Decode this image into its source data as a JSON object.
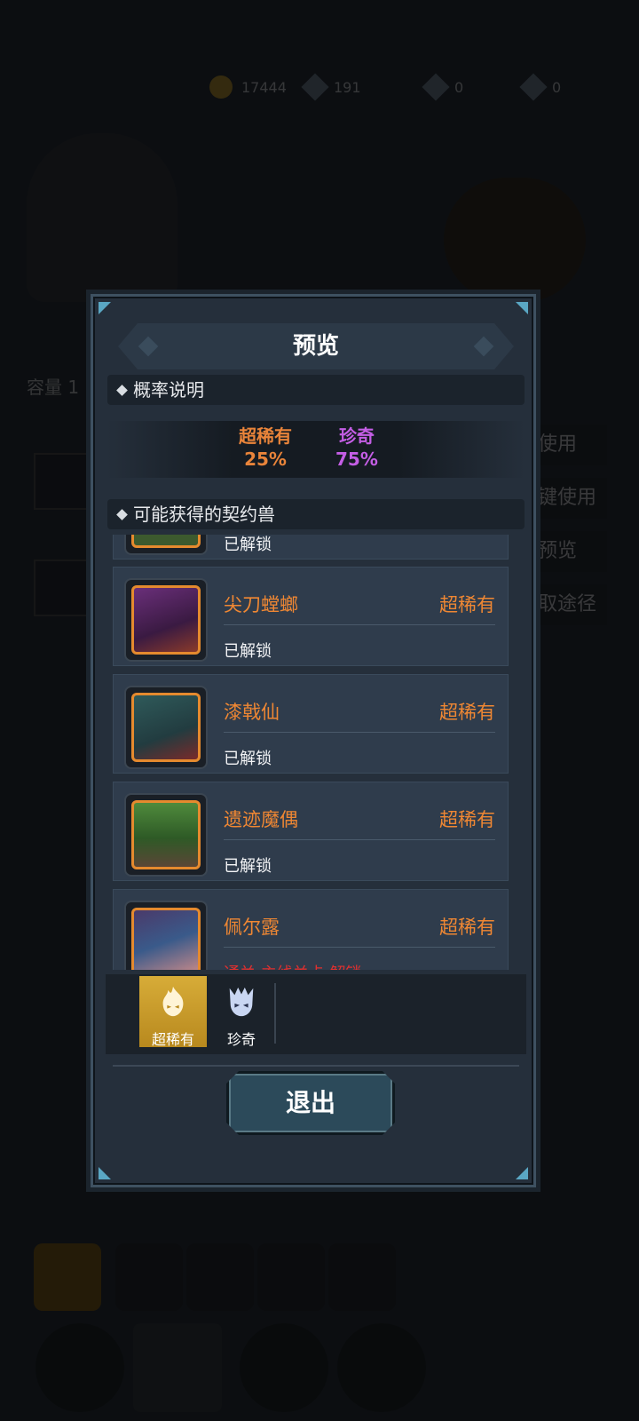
{
  "background": {
    "top_values": [
      "17444",
      "191",
      "0",
      "0"
    ],
    "side_buttons": [
      "使用",
      "键使用",
      "预览",
      "取途径"
    ],
    "left_label": "容量 1"
  },
  "modal": {
    "title": "预览",
    "prob_section_title": "概率说明",
    "probabilities": [
      {
        "label": "超稀有",
        "value": "25%",
        "color": "#e9843a"
      },
      {
        "label": "珍奇",
        "value": "75%",
        "color": "#c45ee5"
      }
    ],
    "list_section_title": "可能获得的契约兽",
    "cards": [
      {
        "name": "",
        "rarity": "",
        "status": "已解锁",
        "portrait_color": "#3c5a2e"
      },
      {
        "name": "尖刀螳螂",
        "rarity": "超稀有",
        "status": "已解锁",
        "portrait_color": "#5a2a6a"
      },
      {
        "name": "漆戟仙",
        "rarity": "超稀有",
        "status": "已解锁",
        "portrait_color": "#2f5a5a"
      },
      {
        "name": "遗迹魔偶",
        "rarity": "超稀有",
        "status": "已解锁",
        "portrait_color": "#3f6a34"
      },
      {
        "name": "佩尔露",
        "rarity": "超稀有",
        "status": "通关 主线关卡 解锁",
        "portrait_color": "#4a3a6a"
      }
    ],
    "tabs": [
      {
        "label": "超稀有",
        "icon": "flame-mask-icon",
        "active": true
      },
      {
        "label": "珍奇",
        "icon": "spiky-mask-icon",
        "active": false
      }
    ],
    "exit_label": "退出"
  }
}
